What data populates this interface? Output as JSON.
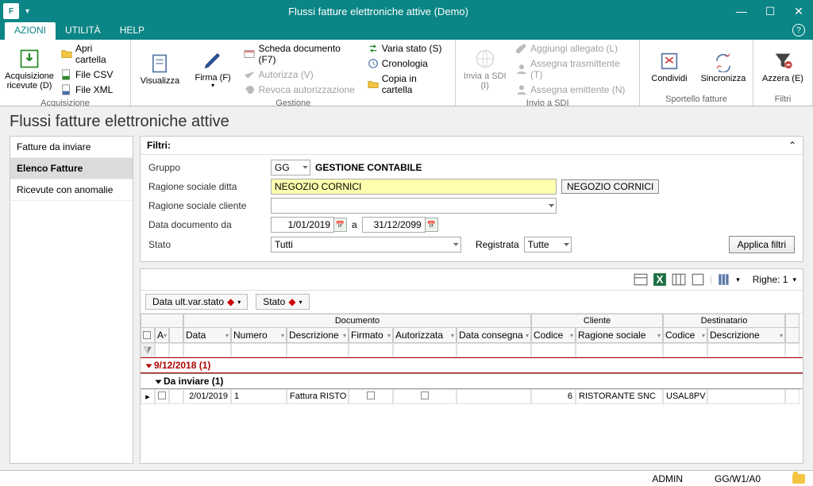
{
  "window": {
    "title": "Flussi fatture elettroniche attive  (Demo)"
  },
  "menu": {
    "azioni": "AZIONI",
    "utilita": "UTILITÀ",
    "help": "HELP"
  },
  "ribbon": {
    "acquisizione_ricevute": "Acquisizione ricevute (D)",
    "apri_cartella": "Apri cartella",
    "file_csv": "File CSV",
    "file_xml": "File XML",
    "acquisizione_label": "Acquisizione",
    "visualizza": "Visualizza",
    "firma": "Firma (F)",
    "scheda_documento": "Scheda documento (F7)",
    "autorizza": "Autorizza (V)",
    "revoca": "Revoca autorizzazione",
    "varia_stato": "Varia stato (S)",
    "cronologia": "Cronologia",
    "copia": "Copia in cartella",
    "gestione_label": "Gestione",
    "invia_sdi": "Invia a SDI (I)",
    "aggiungi_allegato": "Aggiungi allegato (L)",
    "assegna_trasmittente": "Assegna trasmittente (T)",
    "assegna_emittente": "Assegna emittente (N)",
    "invio_sdi_label": "Invio a SDI",
    "condividi": "Condividi",
    "sincronizza": "Sincronizza",
    "sportello_label": "Sportello fatture",
    "azzera": "Azzera (E)",
    "filtri_label": "Filtri"
  },
  "page": {
    "title": "Flussi fatture elettroniche attive"
  },
  "sidenav": {
    "fatture_da_inviare": "Fatture da inviare",
    "elenco_fatture": "Elenco Fatture",
    "ricevute_anomalie": "Ricevute con anomalie"
  },
  "filters": {
    "header": "Filtri:",
    "gruppo_label": "Gruppo",
    "gruppo_value": "GG",
    "gruppo_desc": "GESTIONE CONTABILE",
    "ragione_ditta_label": "Ragione sociale ditta",
    "ragione_ditta_value": "NEGOZIO CORNICI",
    "ragione_ditta_badge": "NEGOZIO CORNICI",
    "ragione_cliente_label": "Ragione sociale cliente",
    "ragione_cliente_value": "",
    "data_doc_label": "Data documento da",
    "data_da": "1/01/2019",
    "a": "a",
    "data_a": "31/12/2099",
    "stato_label": "Stato",
    "stato_value": "Tutti",
    "registrata_label": "Registrata",
    "registrata_value": "Tutte",
    "applica": "Applica filtri"
  },
  "grid": {
    "rows_label": "Righe: 1",
    "group1": "Data ult.var.stato",
    "group2": "Stato",
    "super_documento": "Documento",
    "super_cliente": "Cliente",
    "super_destinatario": "Destinatario",
    "h_a": "A",
    "h_data": "Data",
    "h_numero": "Numero",
    "h_descrizione": "Descrizione",
    "h_firmato": "Firmato",
    "h_autorizzata": "Autorizzata",
    "h_data_consegna": "Data consegna",
    "h_codice": "Codice",
    "h_ragione": "Ragione sociale",
    "h_dest_codice": "Codice",
    "h_dest_descr": "Descrizione",
    "grp_date": "9/12/2018 (1)",
    "grp_stato": "Da inviare (1)",
    "row": {
      "data": "2/01/2019",
      "numero": "1",
      "descrizione": "Fattura RISTO",
      "codice": "6",
      "ragione": "RISTORANTE SNC",
      "dest_codice": "USAL8PV"
    }
  },
  "status": {
    "user": "ADMIN",
    "path": "GG/W1/A0"
  }
}
